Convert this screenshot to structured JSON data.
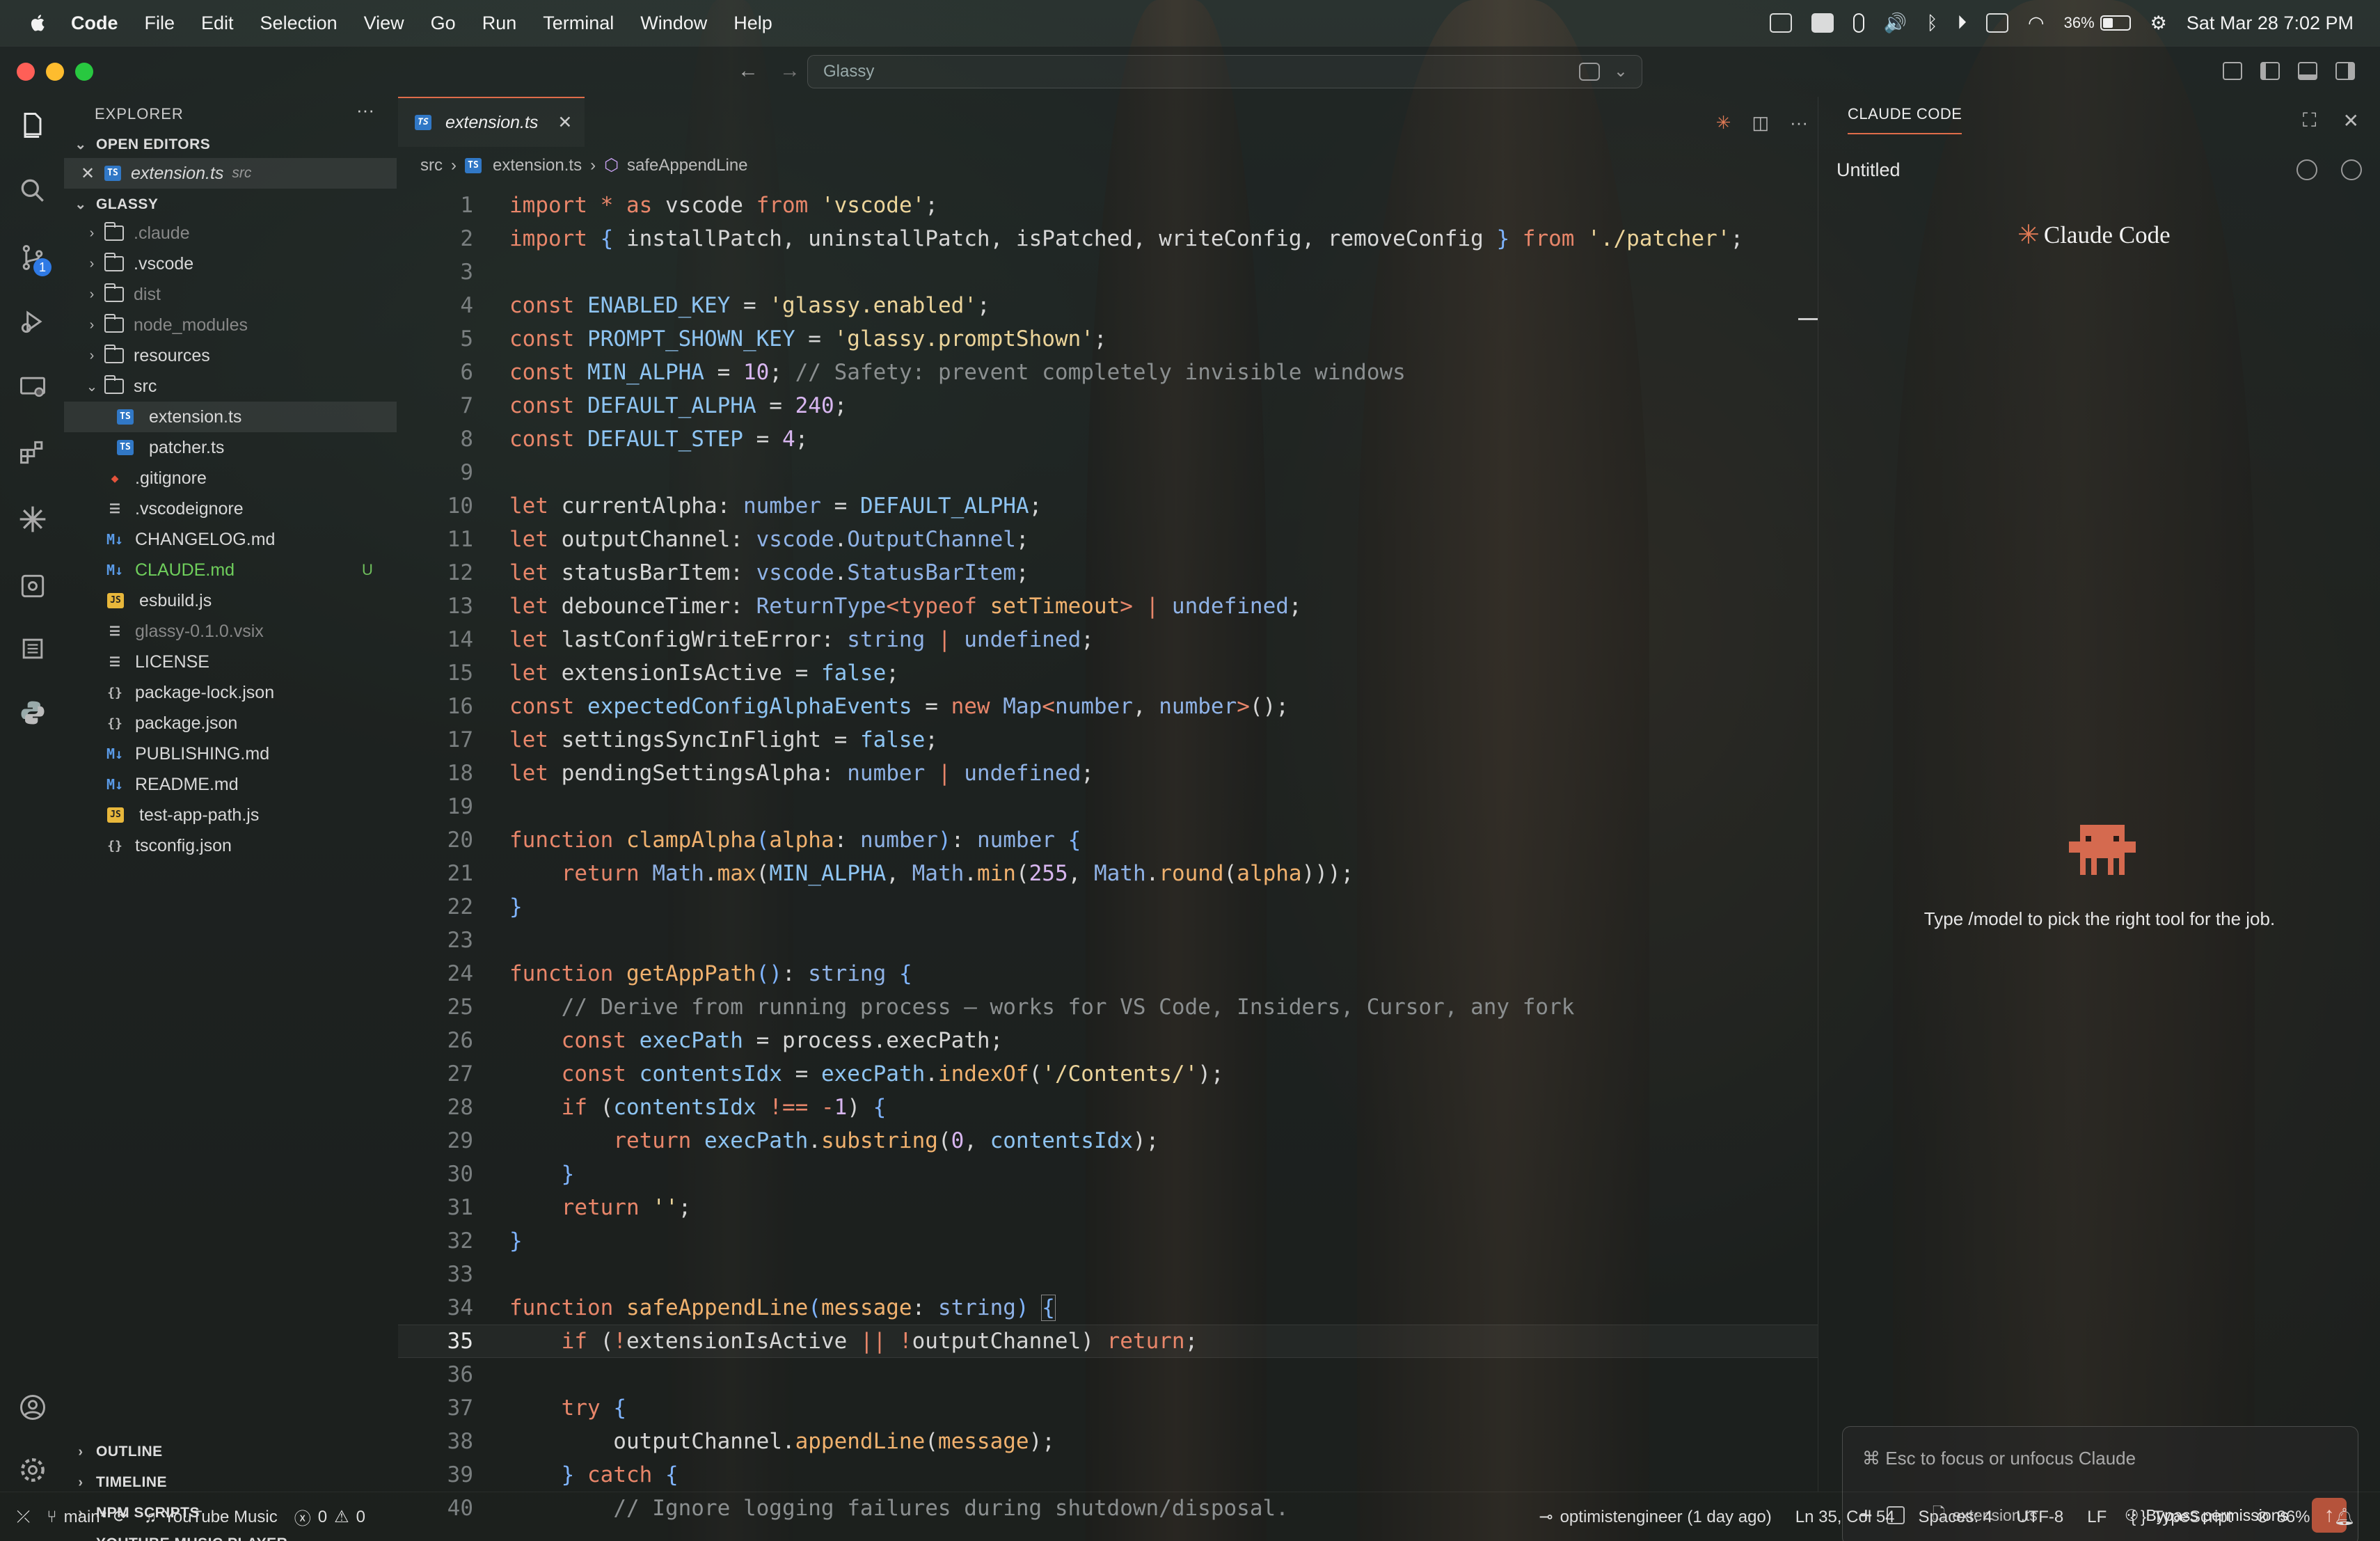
{
  "menubar": {
    "items": [
      "Code",
      "File",
      "Edit",
      "Selection",
      "View",
      "Go",
      "Run",
      "Terminal",
      "Window",
      "Help"
    ],
    "battery": "36%",
    "datetime": "Sat Mar 28  7:02 PM"
  },
  "titlebar": {
    "search": "Glassy"
  },
  "activity": {
    "scm_badge": "1"
  },
  "sidebar": {
    "title": "EXPLORER",
    "more": "···",
    "open_editors_label": "OPEN EDITORS",
    "open_editor": {
      "name": "extension.ts",
      "desc": "src"
    },
    "workspace_label": "GLASSY",
    "tree": [
      {
        "name": ".claude",
        "kind": "folder",
        "dim": true
      },
      {
        "name": ".vscode",
        "kind": "folder"
      },
      {
        "name": "dist",
        "kind": "folder",
        "dim": true
      },
      {
        "name": "node_modules",
        "kind": "folder",
        "dim": true
      },
      {
        "name": "resources",
        "kind": "folder"
      },
      {
        "name": "src",
        "kind": "folder-open"
      },
      {
        "name": "extension.ts",
        "kind": "ts",
        "child": true,
        "selected": true
      },
      {
        "name": "patcher.ts",
        "kind": "ts",
        "child": true
      },
      {
        "name": ".gitignore",
        "kind": "git"
      },
      {
        "name": ".vscodeignore",
        "kind": "txt"
      },
      {
        "name": "CHANGELOG.md",
        "kind": "md"
      },
      {
        "name": "CLAUDE.md",
        "kind": "md",
        "untracked": true
      },
      {
        "name": "esbuild.js",
        "kind": "js"
      },
      {
        "name": "glassy-0.1.0.vsix",
        "kind": "txt",
        "dim": true
      },
      {
        "name": "LICENSE",
        "kind": "txt"
      },
      {
        "name": "package-lock.json",
        "kind": "json"
      },
      {
        "name": "package.json",
        "kind": "json"
      },
      {
        "name": "PUBLISHING.md",
        "kind": "md"
      },
      {
        "name": "README.md",
        "kind": "md"
      },
      {
        "name": "test-app-path.js",
        "kind": "js"
      },
      {
        "name": "tsconfig.json",
        "kind": "json"
      }
    ],
    "untracked_flag": "U",
    "bottom_sections": [
      "OUTLINE",
      "TIMELINE",
      "NPM SCRIPTS",
      "YOUTUBE MUSIC PLAYER"
    ]
  },
  "editor": {
    "tab": "extension.ts",
    "breadcrumbs": [
      "src",
      "extension.ts",
      "safeAppendLine"
    ],
    "current_line": 35
  },
  "panel": {
    "tab": "CLAUDE CODE",
    "session": "Untitled",
    "logo": "Claude Code",
    "hint": "Type /model to pick the right tool for the job.",
    "input_placeholder": "⌘ Esc to focus or unfocus Claude",
    "file_chip": "extension.ts",
    "permissions": "Bypass permissions"
  },
  "status": {
    "branch": "main*",
    "music": "YouTube Music",
    "errors": "0",
    "warnings": "0",
    "blame": "optimistengineer (1 day ago)",
    "position": "Ln 35, Col 54",
    "spaces": "Spaces: 4",
    "encoding": "UTF-8",
    "eol": "LF",
    "language": "TypeScript",
    "zoom": "86%"
  },
  "colors": {
    "accent": "#e06c4a",
    "badge": "#2f7ae5",
    "untracked": "#6fbf5c"
  }
}
